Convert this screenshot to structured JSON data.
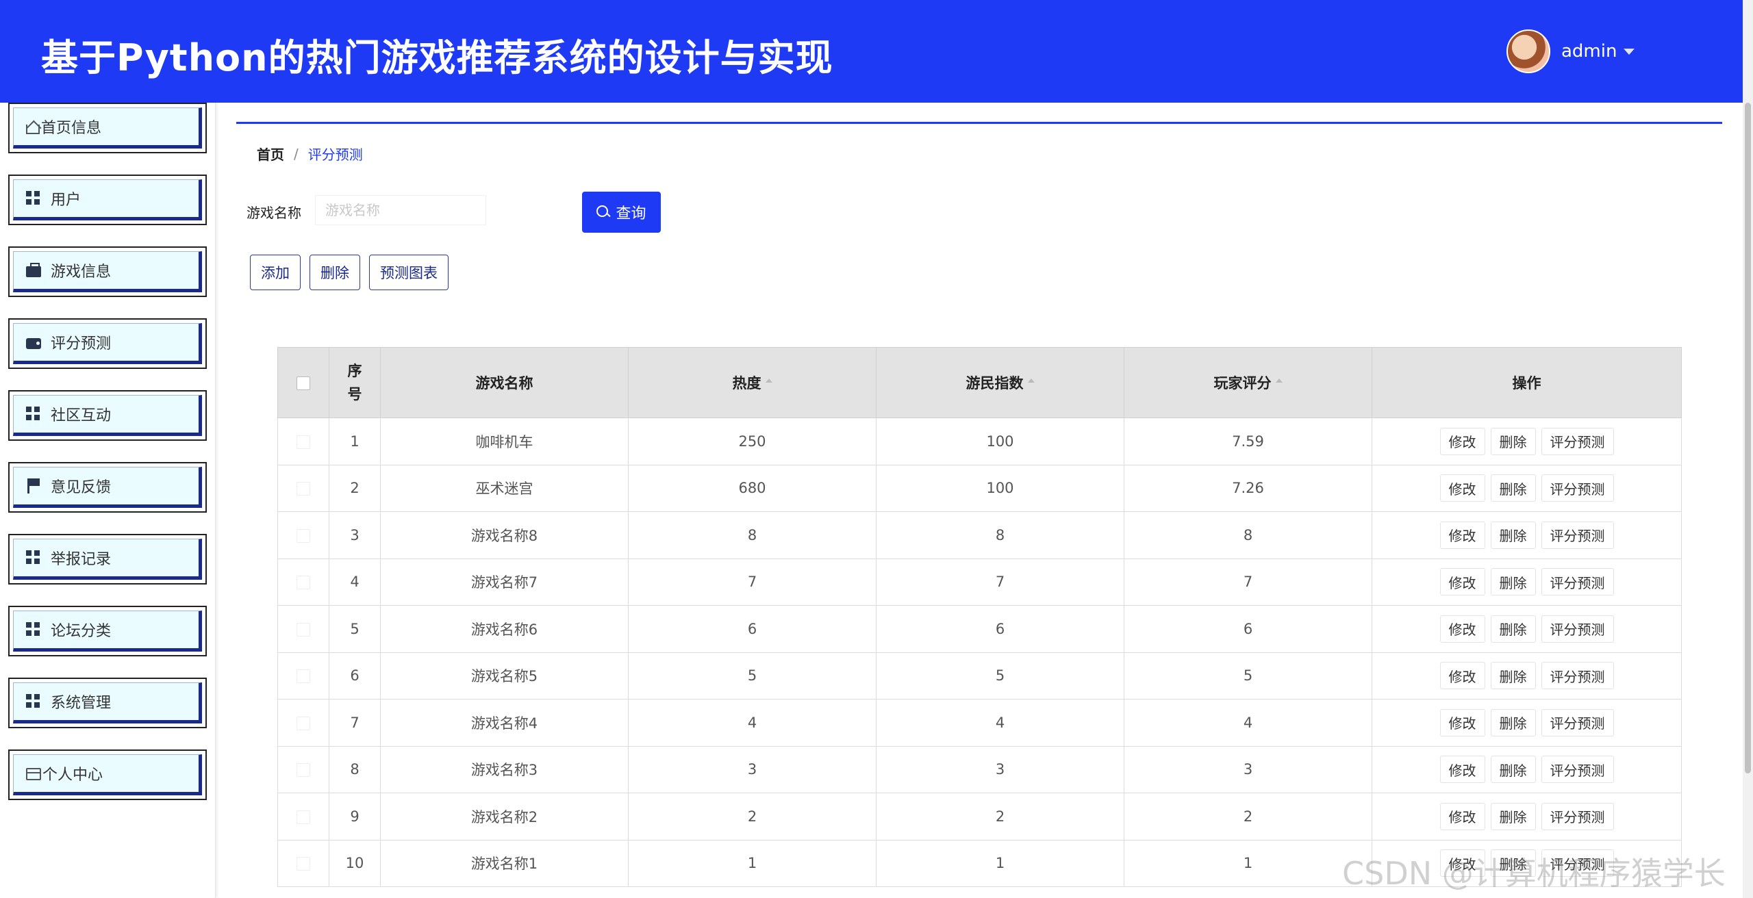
{
  "header": {
    "title": "基于Python的热门游戏推荐系统的设计与实现",
    "user_name": "admin"
  },
  "sidebar": {
    "items": [
      {
        "label": "首页信息",
        "icon": "home-icon"
      },
      {
        "label": "用户",
        "icon": "grid-icon"
      },
      {
        "label": "游戏信息",
        "icon": "briefcase-icon"
      },
      {
        "label": "评分预测",
        "icon": "wallet-icon"
      },
      {
        "label": "社区互动",
        "icon": "grid-icon"
      },
      {
        "label": "意见反馈",
        "icon": "flag-icon"
      },
      {
        "label": "举报记录",
        "icon": "grid-icon"
      },
      {
        "label": "论坛分类",
        "icon": "grid-icon"
      },
      {
        "label": "系统管理",
        "icon": "grid-icon"
      },
      {
        "label": "个人中心",
        "icon": "card-icon"
      }
    ]
  },
  "breadcrumb": {
    "home": "首页",
    "separator": "/",
    "current": "评分预测"
  },
  "search": {
    "label": "游戏名称",
    "placeholder": "游戏名称",
    "value": "",
    "button_label": "查询"
  },
  "actions": {
    "add": "添加",
    "delete": "删除",
    "chart": "预测图表"
  },
  "table": {
    "columns": [
      "序号",
      "游戏名称",
      "热度",
      "游民指数",
      "玩家评分",
      "操作"
    ],
    "rows": [
      {
        "index": "1",
        "name": "咖啡机车",
        "heat": "250",
        "index_score": "100",
        "rating": "7.59"
      },
      {
        "index": "2",
        "name": "巫术迷宫",
        "heat": "680",
        "index_score": "100",
        "rating": "7.26"
      },
      {
        "index": "3",
        "name": "游戏名称8",
        "heat": "8",
        "index_score": "8",
        "rating": "8"
      },
      {
        "index": "4",
        "name": "游戏名称7",
        "heat": "7",
        "index_score": "7",
        "rating": "7"
      },
      {
        "index": "5",
        "name": "游戏名称6",
        "heat": "6",
        "index_score": "6",
        "rating": "6"
      },
      {
        "index": "6",
        "name": "游戏名称5",
        "heat": "5",
        "index_score": "5",
        "rating": "5"
      },
      {
        "index": "7",
        "name": "游戏名称4",
        "heat": "4",
        "index_score": "4",
        "rating": "4"
      },
      {
        "index": "8",
        "name": "游戏名称3",
        "heat": "3",
        "index_score": "3",
        "rating": "3"
      },
      {
        "index": "9",
        "name": "游戏名称2",
        "heat": "2",
        "index_score": "2",
        "rating": "2"
      },
      {
        "index": "10",
        "name": "游戏名称1",
        "heat": "1",
        "index_score": "1",
        "rating": "1"
      }
    ],
    "row_actions": {
      "edit": "修改",
      "delete": "删除",
      "predict": "评分预测"
    }
  },
  "watermark": "CSDN @计算机程序猿学长",
  "colors": {
    "primary": "#1f3af5",
    "sidebar_bg": "#eafcff",
    "header_bg": "#e3e3e3"
  }
}
